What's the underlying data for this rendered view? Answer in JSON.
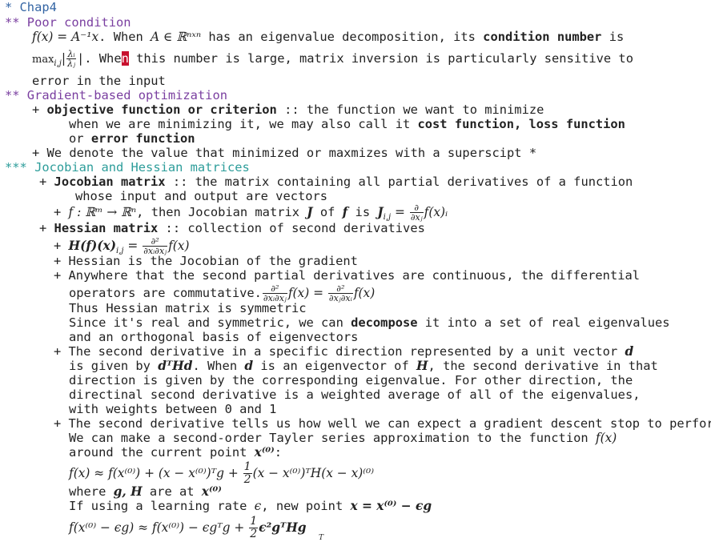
{
  "lines": {
    "chap4": "* Chap4",
    "poor_condition": "** Poor condition",
    "l3_math": "f(x) = A⁻¹x",
    "l3_a": ". When ",
    "l3_m2": "A ∈ ℝⁿˣⁿ",
    "l3_b": " has an eigenvalue decomposition, its ",
    "l3_bold": "condition number",
    "l3_c": " is",
    "l4_max": "max",
    "l4_sub": "i,j",
    "l4_num": "λᵢ",
    "l4_den": "λⱼ",
    "l4_a": "|. Whe",
    "l4_cursor": "n",
    "l4_b": " this number is large, matrix inversion is particularly sensitive to",
    "l5": "error in the input",
    "grad_opt": "** Gradient-based optimization",
    "l7_a": "+ ",
    "l7_bold": "objective function or criterion",
    "l7_b": " :: the function we want to minimize",
    "l8_a": "when we are minimizing it, we may also call it ",
    "l8_bold": "cost function, loss function",
    "l9_a": "or ",
    "l9_bold": "error function",
    "l10": "+ We denote the value that minimized or maxmizes with a superscipt *",
    "jacobian_head": "*** Jocobian and Hessian matrices",
    "l12_a": "+ ",
    "l12_bold": "Jocobian matrix",
    "l12_b": " :: the matrix containing all partial derivatives of a function",
    "l13": "whose input and output are vectors",
    "l14_a": "+ ",
    "l14_m1": "f : ℝᵐ → ℝⁿ",
    "l14_b": ", then Jocobian matrix ",
    "l14_m2": "J",
    "l14_c": " of ",
    "l14_m3": "f",
    "l14_d": " is ",
    "l14_m4": "J",
    "l14_sub": "i,j",
    "l14_eq": " = ",
    "l14_fn": "∂",
    "l14_fd": "∂xⱼ",
    "l14_m5": "f(x)ᵢ",
    "l15_a": "+ ",
    "l15_bold": "Hessian matrix",
    "l15_b": " :: collection of second derivatives",
    "l16_a": "+ ",
    "l16_m1": "H(f)(x)",
    "l16_sub": "i,j",
    "l16_eq": " = ",
    "l16_fn": "∂²",
    "l16_fd": "∂xᵢ∂xⱼ",
    "l16_m2": "f(x)",
    "l17": "+ Hessian is the Jocobian of the gradient",
    "l18": "+ Anywhere that the second partial derivatives are continuous, the differential",
    "l19_a": "operators are commutative.",
    "l19_fn1": "∂²",
    "l19_fd1": "∂xᵢ∂xⱼ",
    "l19_m1": "f(x) = ",
    "l19_fn2": "∂²",
    "l19_fd2": "∂xⱼ∂xᵢ",
    "l19_m2": "f(x)",
    "l20": "Thus Hessian matrix is symmetric",
    "l21_a": "Since it's real and symmetric, we can ",
    "l21_bold": "decompose",
    "l21_b": " it into a set of real eigenvalues",
    "l22": "and an orthogonal basis of eigenvectors",
    "l23_a": "+ The second derivative in a specific direction represented by a unit vector ",
    "l23_m": "d",
    "l24_a": "is given by ",
    "l24_m1": "dᵀHd",
    "l24_b": ". When ",
    "l24_m2": "d",
    "l24_c": " is an eigenvector of ",
    "l24_m3": "H",
    "l24_d": ", the second derivative in that",
    "l25": "direction is given by the corresponding eigenvalue. For other direction, the",
    "l26": "directinal second derivative is a weighted average of all of the eigenvalues,",
    "l27": "with weights between 0 and 1",
    "l28": "+ The second derivative tells us how well we can expect a gradient descent stop to perform",
    "l29_a": "We can make a second-order Tayler series approximation to the function ",
    "l29_m": "f(x)",
    "l30_a": "around the current point ",
    "l30_m": "x⁽⁰⁾",
    "l30_b": ":",
    "l31_m1": "f(x) ≈ f(x⁽⁰⁾) + (x − x⁽⁰⁾)ᵀg + ",
    "l31_fn": "1",
    "l31_fd": "2",
    "l31_m2": "(x − x⁽⁰⁾)ᵀH(x − x)⁽⁰⁾",
    "l32_a": "where ",
    "l32_m1": "g, H",
    "l32_b": " are at ",
    "l32_m2": "x⁽⁰⁾",
    "l33_a": "If using a learning rate ",
    "l33_m1": "ϵ",
    "l33_b": ", new point ",
    "l33_m2": "x = x⁽⁰⁾ − ϵg",
    "l34_m1": "f(x⁽⁰⁾ − ϵg) ≈ f(x⁽⁰⁾) − ϵgᵀg + ",
    "l34_fn": "1",
    "l34_fd": "2",
    "l34_m2": "ϵ²gᵀHg",
    "l35_frag": "T"
  }
}
